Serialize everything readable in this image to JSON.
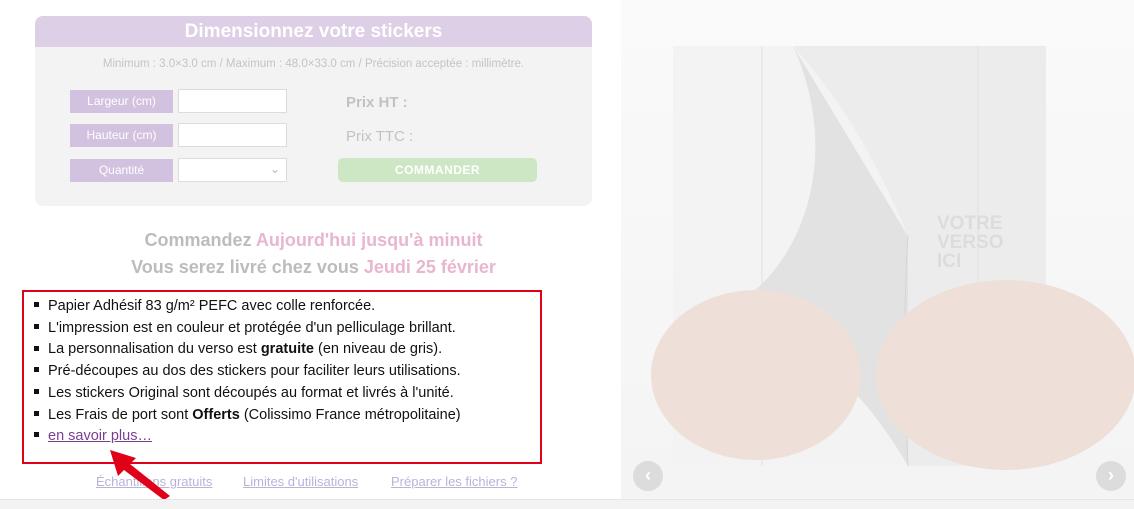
{
  "form": {
    "title": "Dimensionnez votre stickers",
    "subtitle": "Minimum : 3.0×3.0 cm / Maximum : 48.0×33.0 cm / Précision acceptée : millimètre.",
    "width_label": "Largeur (cm)",
    "height_label": "Hauteur (cm)",
    "quantity_label": "Quantité",
    "width_value": "",
    "height_value": "",
    "quantity_value": "",
    "price_ht": "Prix HT :",
    "price_ttc": "Prix TTC :",
    "order_button": "COMMANDER"
  },
  "delivery": {
    "line1_prefix": "Commandez ",
    "line1_highlight": "Aujourd'hui jusqu'à minuit",
    "line2_prefix": "Vous serez livré chez vous ",
    "line2_highlight": "Jeudi 25 février"
  },
  "features": {
    "items": [
      {
        "text": "Papier Adhésif 83 g/m² PEFC avec colle renforcée."
      },
      {
        "text": "L'impression est en couleur et protégée d'un pelliculage brillant."
      },
      {
        "before": "La personnalisation du verso est ",
        "bold": "gratuite",
        "after": " (en niveau de gris)."
      },
      {
        "text": "Pré-découpes au dos des stickers pour faciliter leurs utilisations."
      },
      {
        "text": "Les stickers Original sont découpés au format et livrés à l'unité."
      },
      {
        "before": "Les Frais de port sont ",
        "bold": "Offerts",
        "after": " (Colissimo France métropolitaine)"
      }
    ],
    "more_link": "en savoir plus…"
  },
  "footer_links": {
    "samples": "Échantillons gratuits",
    "limits": "Limites d'utilisations",
    "prepare": "Préparer les fichiers ?"
  },
  "image": {
    "verso_line1": "VOTRE",
    "verso_line2": "VERSO",
    "verso_line3": "ICI",
    "prev_icon": "chevron-left-icon",
    "next_icon": "chevron-right-icon"
  },
  "colors": {
    "accent_purple": "#dccfe6",
    "highlight_pink": "#e8b6cf",
    "order_green": "#cde6c4",
    "annotation_red": "#e0001a"
  }
}
